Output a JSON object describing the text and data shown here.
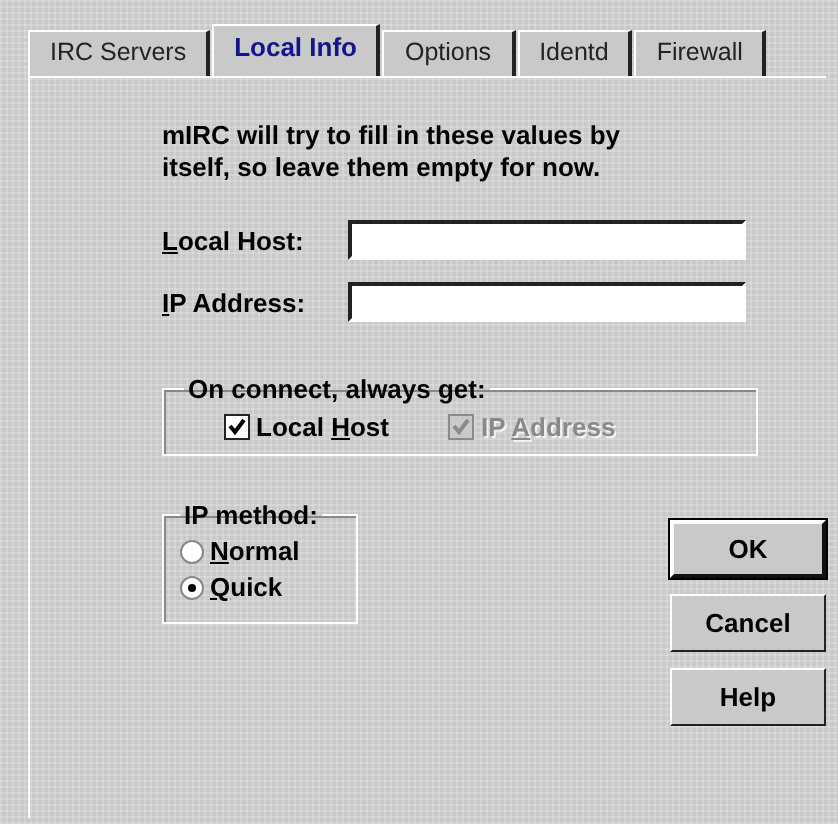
{
  "tabs": [
    {
      "label": "IRC Servers",
      "selected": false
    },
    {
      "label": "Local Info",
      "selected": true
    },
    {
      "label": "Options",
      "selected": false
    },
    {
      "label": "Identd",
      "selected": false
    },
    {
      "label": "Firewall",
      "selected": false
    }
  ],
  "intro": "mIRC will try to fill in these values by itself, so leave them empty for now.",
  "fields": [
    {
      "label": {
        "key": "L",
        "rest": "ocal Host:"
      }
    },
    {
      "label": {
        "key": "I",
        "rest": "P Address:"
      }
    }
  ],
  "connect_group": {
    "title": "On connect, always get:",
    "options": [
      {
        "label": {
          "pre": "Local ",
          "key": "H",
          "rest": "ost"
        },
        "checked": true,
        "disabled": false
      },
      {
        "label": {
          "pre": "IP ",
          "key": "A",
          "rest": "ddress"
        },
        "checked": true,
        "disabled": true
      }
    ]
  },
  "ip_method": {
    "title": "IP method:",
    "options": [
      {
        "label": {
          "key": "N",
          "rest": "ormal"
        },
        "selected": false
      },
      {
        "label": {
          "key": "Q",
          "rest": "uick"
        },
        "selected": true
      }
    ]
  },
  "buttons": [
    {
      "label": "OK",
      "default": true
    },
    {
      "label": "Cancel",
      "default": false
    },
    {
      "label": "Help",
      "default": false
    }
  ]
}
